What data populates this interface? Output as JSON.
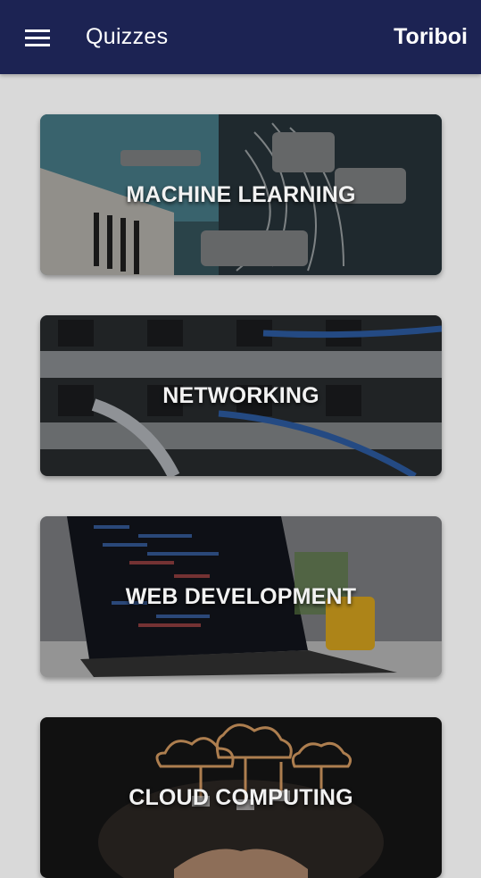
{
  "app_bar": {
    "title": "Quizzes",
    "user_name": "Toriboi",
    "menu_icon": "hamburger-menu-icon",
    "background_color": "#1c2353"
  },
  "quiz_categories": [
    {
      "label": "MACHINE LEARNING",
      "image": "robot-arm-image"
    },
    {
      "label": "NETWORKING",
      "image": "network-switch-cables-image"
    },
    {
      "label": "WEB DEVELOPMENT",
      "image": "laptop-code-image"
    },
    {
      "label": "CLOUD COMPUTING",
      "image": "cloud-hands-image"
    }
  ]
}
